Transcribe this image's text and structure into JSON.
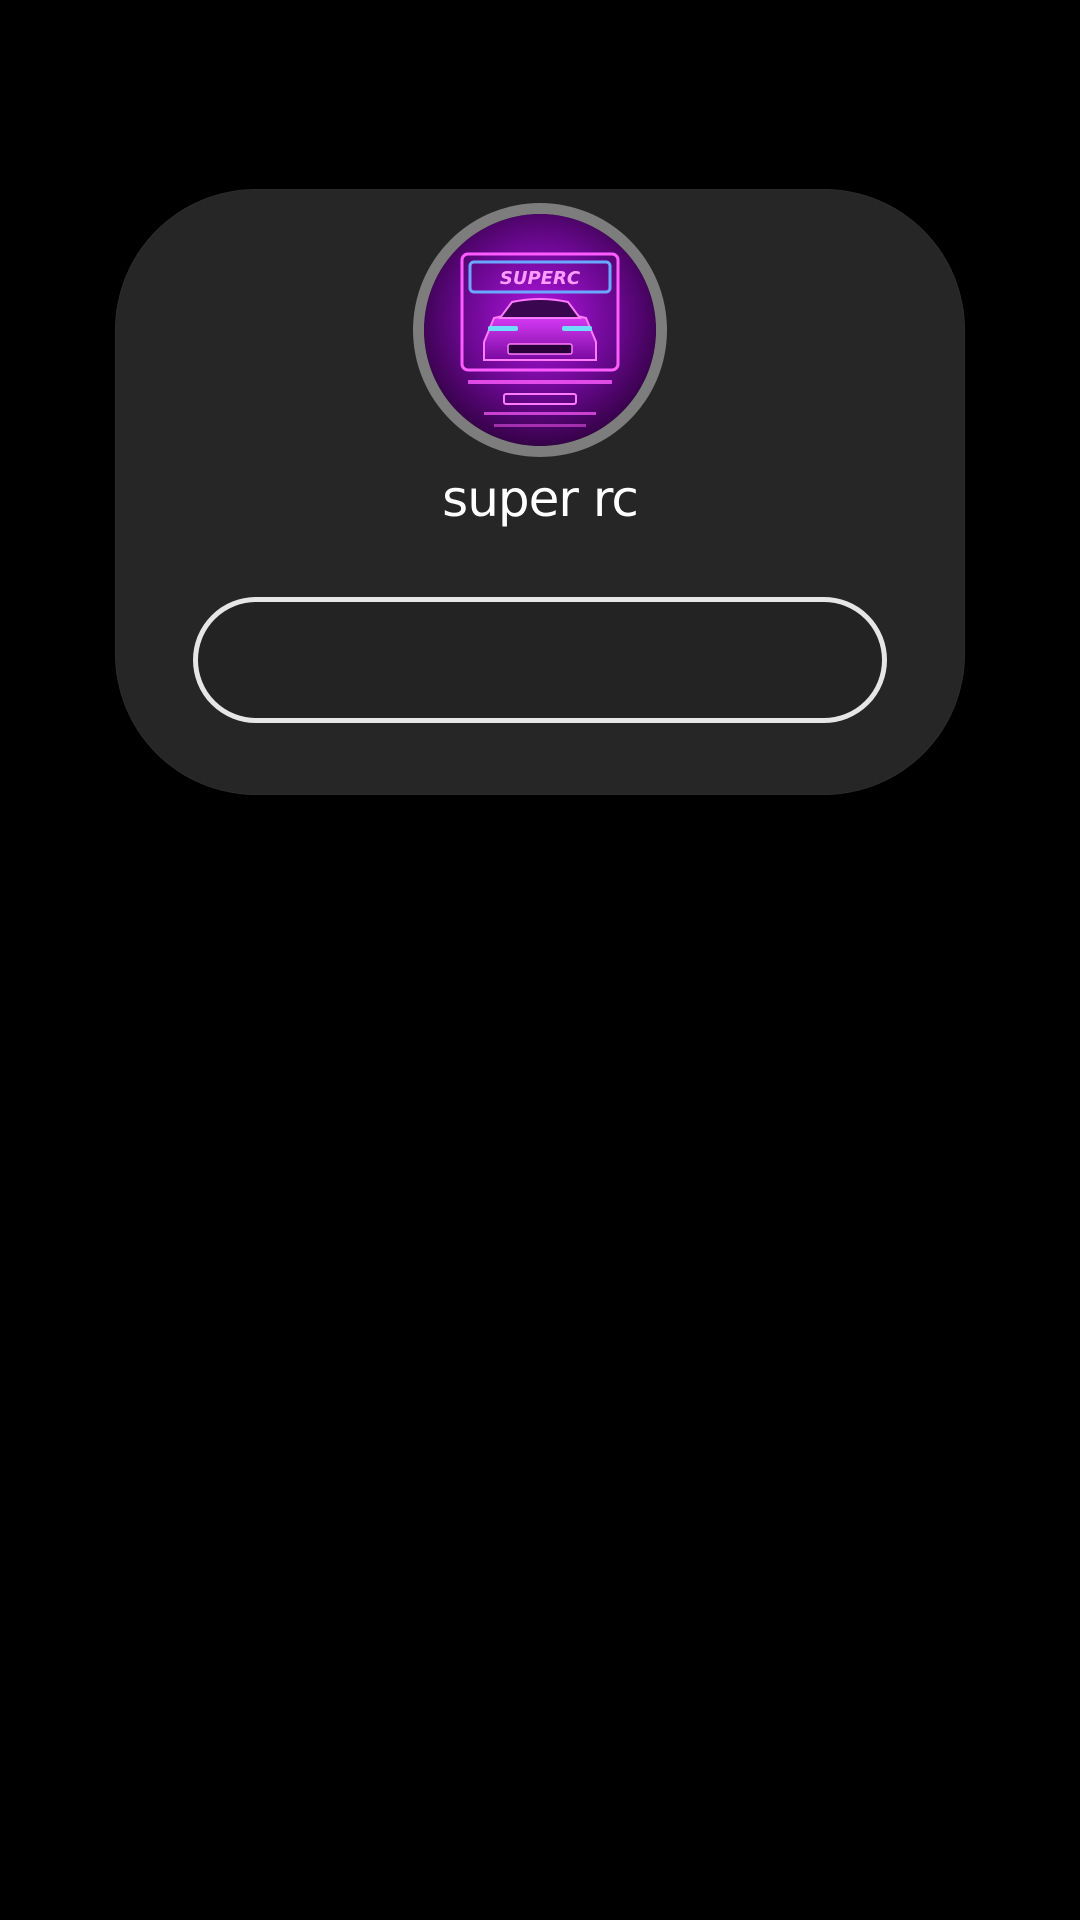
{
  "profile": {
    "name": "super rc",
    "avatar_icon": "neon-car-logo-icon",
    "avatar_logo_text": "SUPERC"
  },
  "links": [
    {
      "label": ""
    }
  ],
  "colors": {
    "background": "#000000",
    "card": "#262626",
    "button_border": "#e6e6e6",
    "avatar_ring": "#7d7d7d",
    "neon_magenta": "#d21cff",
    "neon_blue": "#5aa0ff"
  }
}
